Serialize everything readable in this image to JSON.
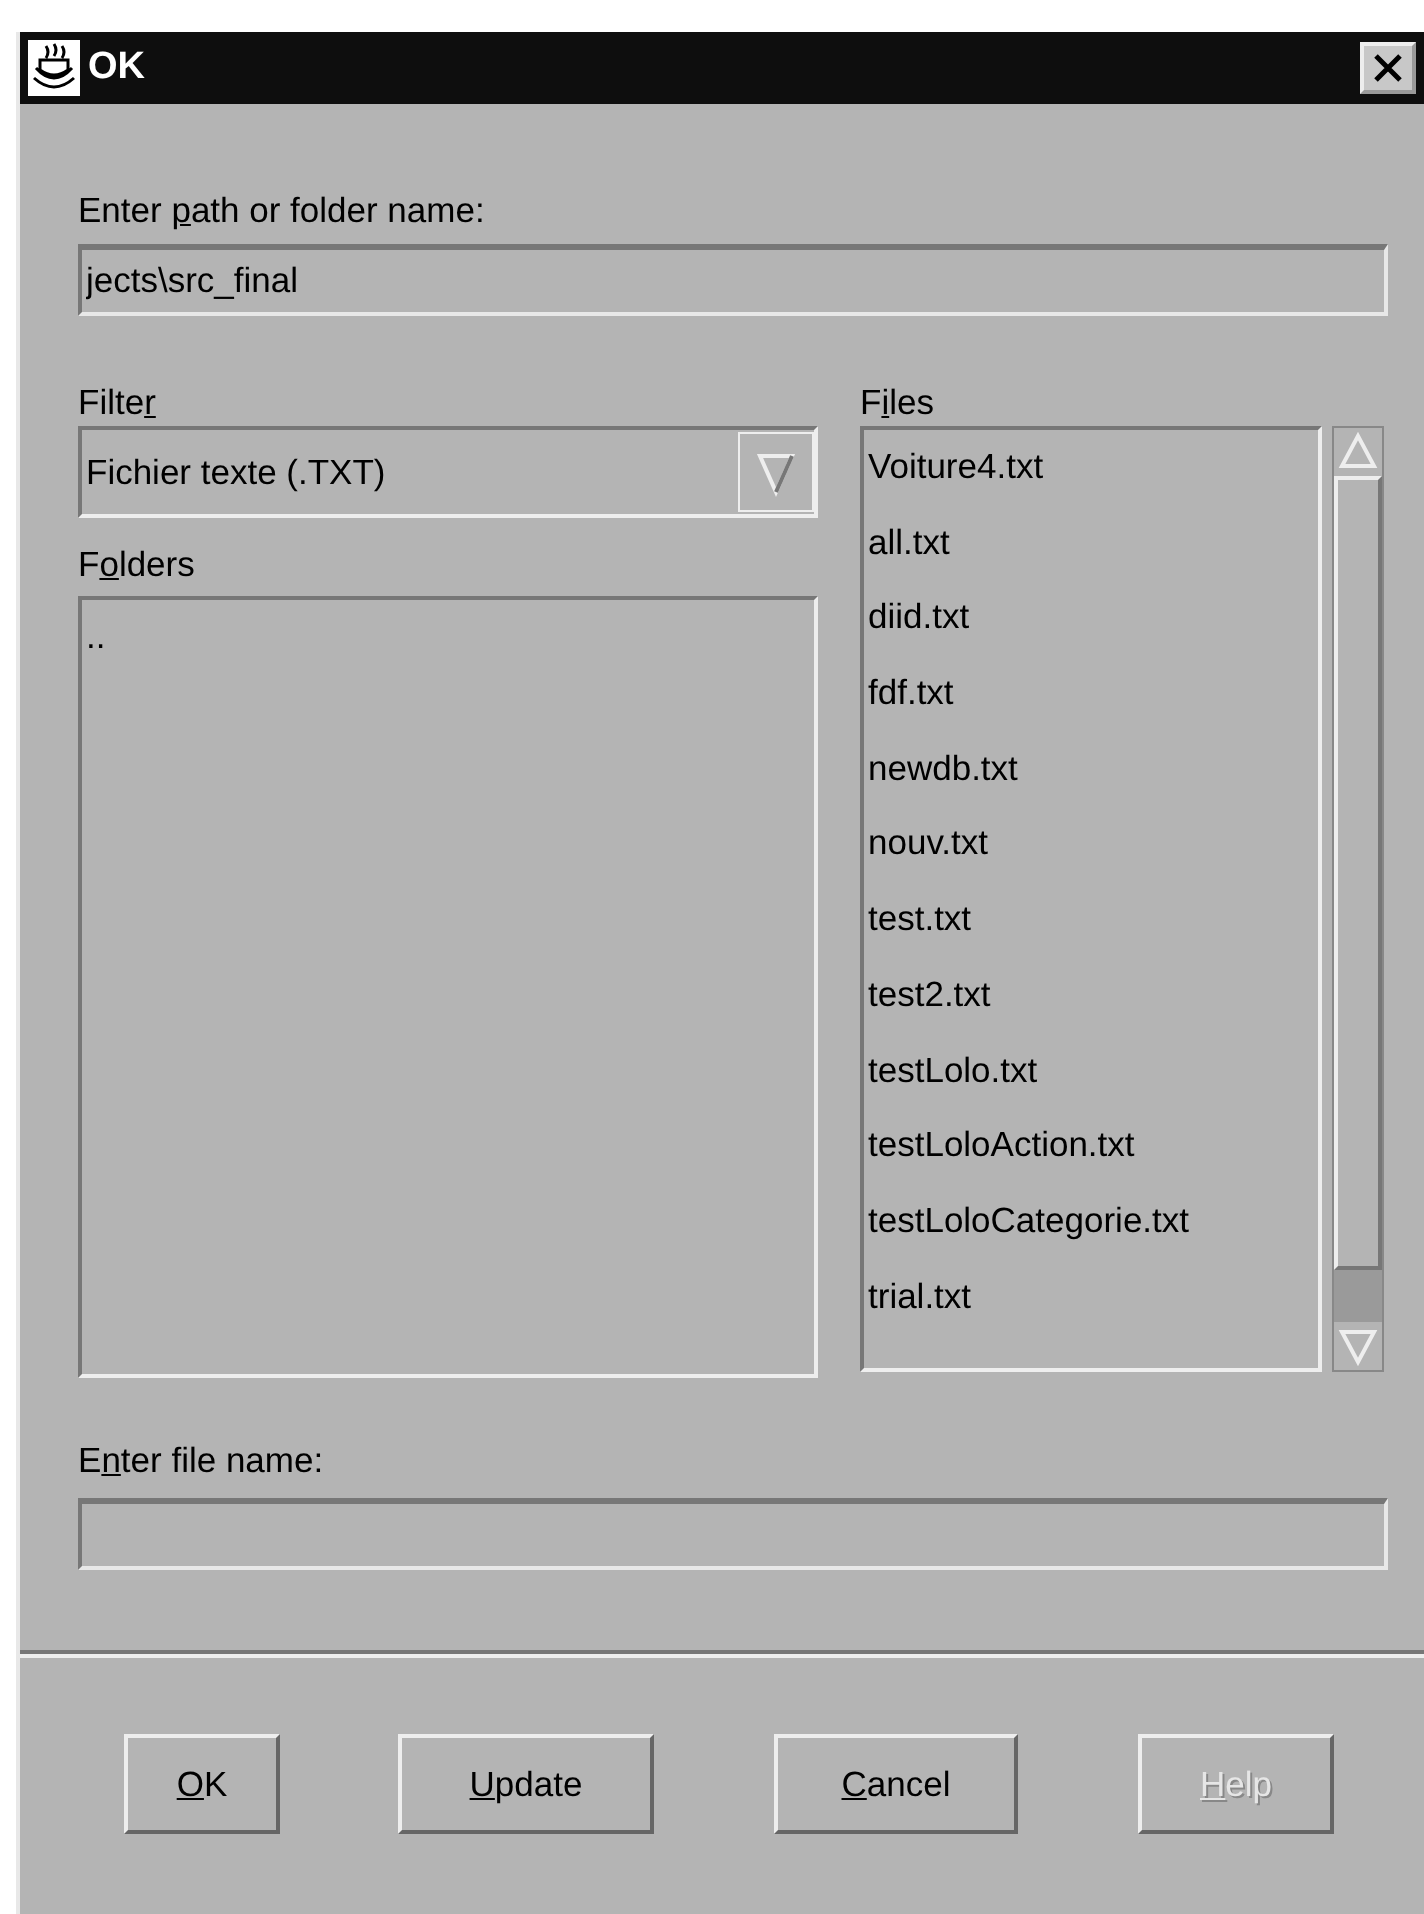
{
  "window": {
    "title": "OK"
  },
  "path": {
    "label": {
      "before": "Enter ",
      "mnemonic": "p",
      "after": "ath or folder name:"
    },
    "value": "jects\\src_final"
  },
  "filter": {
    "label": {
      "before": "Filte",
      "mnemonic": "r"
    },
    "value": "Fichier texte (.TXT)"
  },
  "folders": {
    "label": {
      "before": "F",
      "mnemonic": "o",
      "after": "lders"
    },
    "items": [
      ".."
    ]
  },
  "files": {
    "label": {
      "before": "F",
      "mnemonic": "i",
      "after": "les"
    },
    "items": [
      "Voiture4.txt",
      "all.txt",
      "diid.txt",
      "fdf.txt",
      "newdb.txt",
      "nouv.txt",
      "test.txt",
      "test2.txt",
      "testLolo.txt",
      "testLoloAction.txt",
      "testLoloCategorie.txt",
      "trial.txt"
    ]
  },
  "file_name": {
    "label": {
      "before": "E",
      "mnemonic": "n",
      "after": "ter file name:"
    }
  },
  "buttons": [
    {
      "label": {
        "mnemonic": "O",
        "after": "K"
      },
      "disabled": false
    },
    {
      "label": {
        "mnemonic": "U",
        "after": "pdate"
      },
      "disabled": false
    },
    {
      "label": {
        "mnemonic": "C",
        "after": "ancel"
      },
      "disabled": false
    },
    {
      "label": {
        "mnemonic": "H",
        "after": "elp"
      },
      "disabled": true
    }
  ]
}
